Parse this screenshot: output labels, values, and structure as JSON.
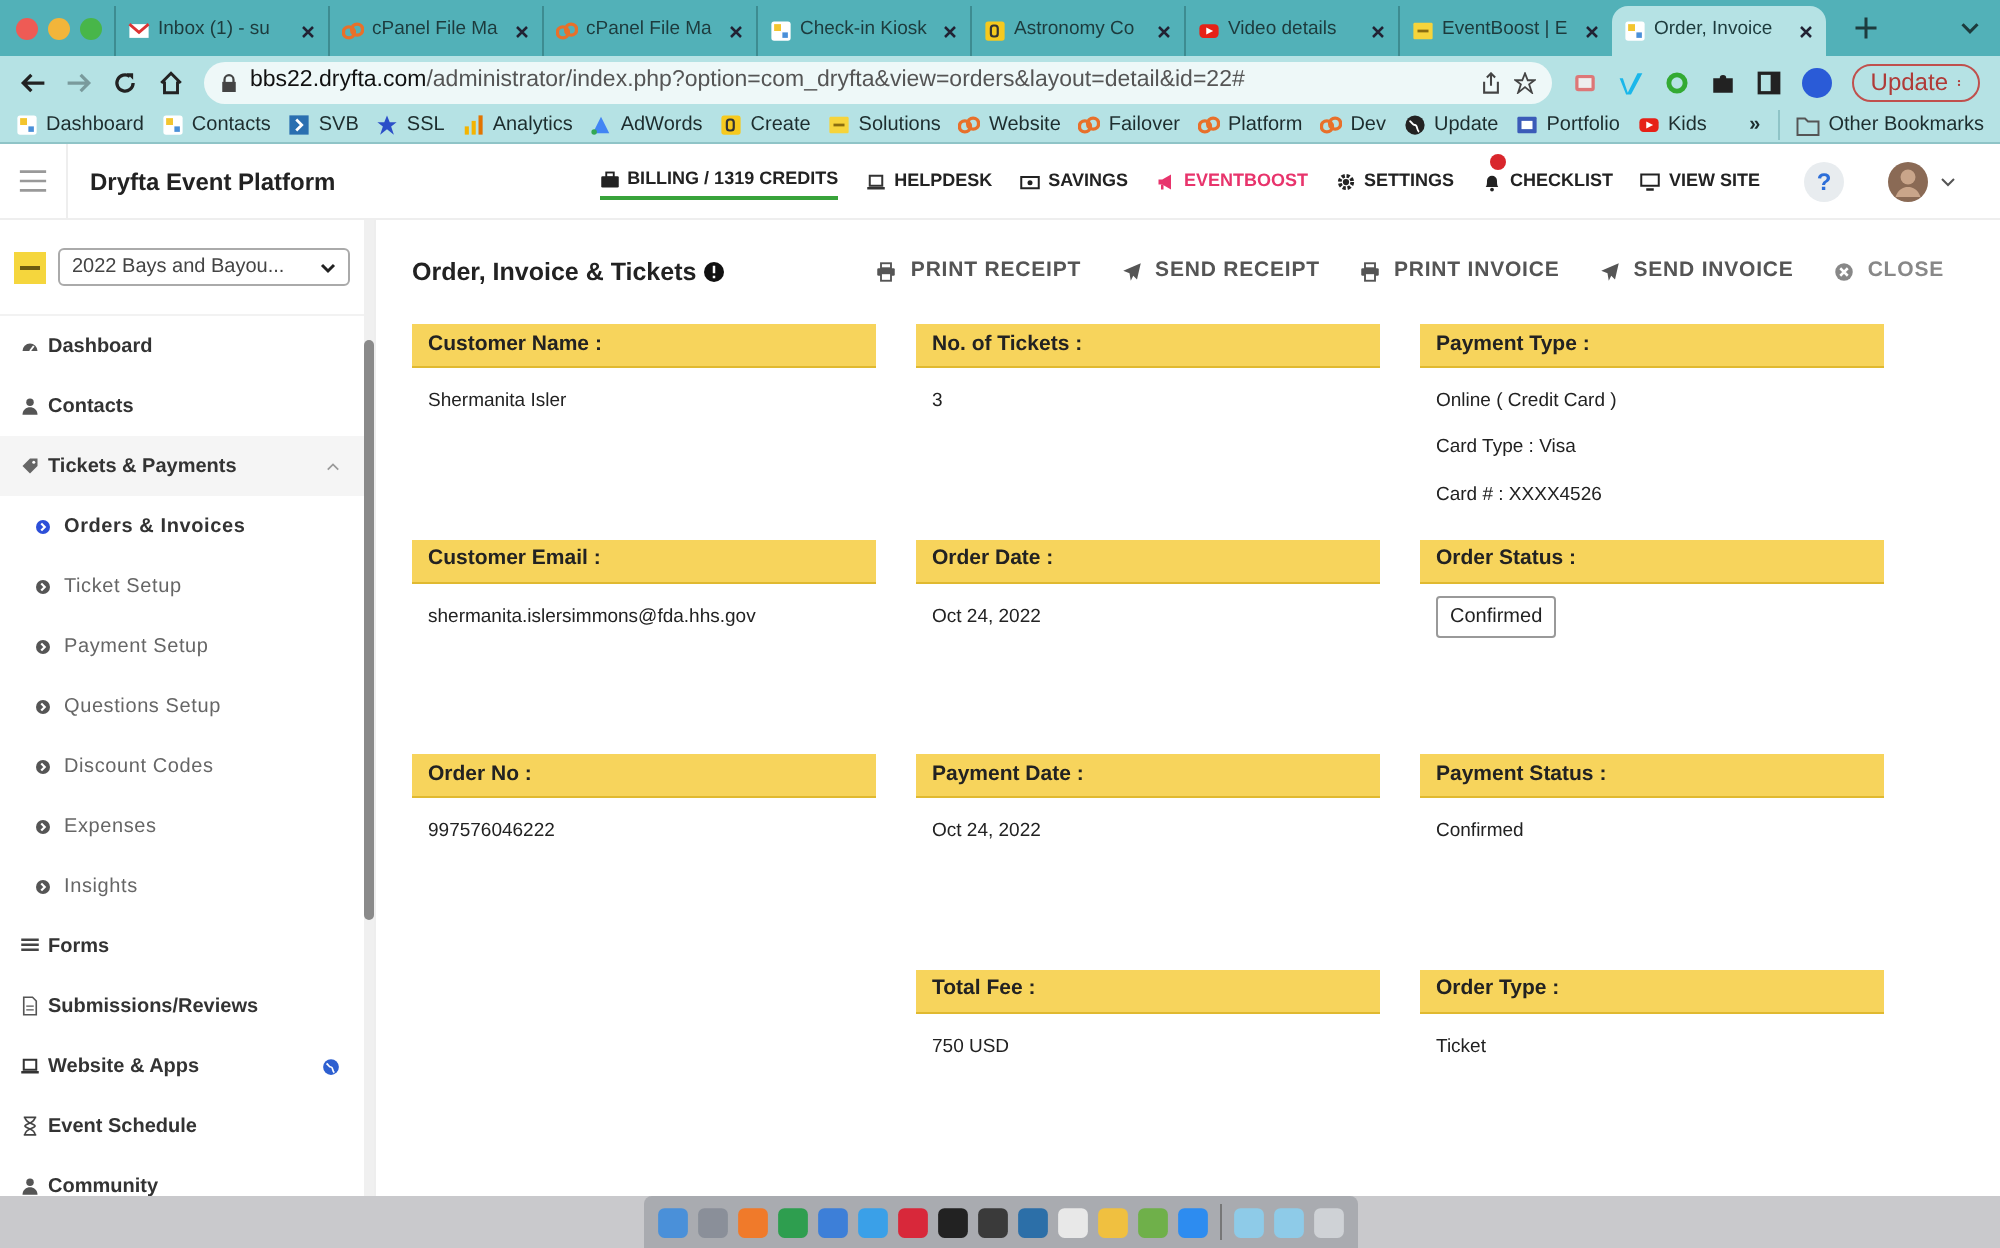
{
  "browser": {
    "tabs": [
      {
        "title": "Inbox (1) - su",
        "selected": false
      },
      {
        "title": "cPanel File Ma",
        "selected": false
      },
      {
        "title": "cPanel File Ma",
        "selected": false
      },
      {
        "title": "Check-in Kiosk",
        "selected": false
      },
      {
        "title": "Astronomy Co",
        "selected": false
      },
      {
        "title": "Video details",
        "selected": false
      },
      {
        "title": "EventBoost | E",
        "selected": false
      },
      {
        "title": "Order, Invoice",
        "selected": true
      }
    ],
    "url_host": "bbs22.dryfta.com",
    "url_path": "/administrator/index.php?option=com_dryfta&view=orders&layout=detail&id=22#",
    "update_button": "Update",
    "bookmarks": [
      "Dashboard",
      "Contacts",
      "SVB",
      "SSL",
      "Analytics",
      "AdWords",
      "Create",
      "Solutions",
      "Website",
      "Failover",
      "Platform",
      "Dev",
      "Update",
      "Portfolio",
      "Kids"
    ],
    "more_bookmarks": "»",
    "other_bookmarks": "Other Bookmarks"
  },
  "app": {
    "title": "Dryfta Event Platform",
    "nav": [
      {
        "label": "BILLING / 1319 CREDITS",
        "underlined": true,
        "accent": false,
        "badge": false
      },
      {
        "label": "HELPDESK",
        "underlined": false,
        "accent": false,
        "badge": false
      },
      {
        "label": "SAVINGS",
        "underlined": false,
        "accent": false,
        "badge": false
      },
      {
        "label": "EVENTBOOST",
        "underlined": false,
        "accent": true,
        "badge": false
      },
      {
        "label": "SETTINGS",
        "underlined": false,
        "accent": false,
        "badge": false
      },
      {
        "label": "CHECKLIST",
        "underlined": false,
        "accent": false,
        "badge": true
      },
      {
        "label": "VIEW SITE",
        "underlined": false,
        "accent": false,
        "badge": false
      }
    ],
    "help": "?"
  },
  "sidebar": {
    "event_select": "2022 Bays and Bayou...",
    "items": [
      {
        "label": "Dashboard",
        "badge": false
      },
      {
        "label": "Contacts",
        "badge": false
      },
      {
        "label": "Tickets & Payments",
        "expanded": true,
        "badge": false,
        "children": [
          {
            "label": "Orders & Invoices",
            "selected": true
          },
          {
            "label": "Ticket Setup",
            "selected": false
          },
          {
            "label": "Payment Setup",
            "selected": false
          },
          {
            "label": "Questions Setup",
            "selected": false
          },
          {
            "label": "Discount Codes",
            "selected": false
          },
          {
            "label": "Expenses",
            "selected": false
          },
          {
            "label": "Insights",
            "selected": false
          }
        ]
      },
      {
        "label": "Forms",
        "badge": false
      },
      {
        "label": "Submissions/Reviews",
        "badge": false
      },
      {
        "label": "Website & Apps",
        "badge": true
      },
      {
        "label": "Event Schedule",
        "badge": false
      },
      {
        "label": "Community",
        "badge": false
      }
    ]
  },
  "page": {
    "title": "Order, Invoice & Tickets",
    "actions": [
      "PRINT RECEIPT",
      "SEND RECEIPT",
      "PRINT INVOICE",
      "SEND INVOICE",
      "CLOSE"
    ],
    "columns": [
      [
        {
          "label": "Customer Name :",
          "kind": "text",
          "lines": [
            "Shermanita Isler"
          ]
        },
        {
          "label": "Customer Email :",
          "kind": "text",
          "lines": [
            "shermanita.islersimmons@fda.hhs.gov"
          ]
        },
        {
          "label": "Order No :",
          "kind": "text",
          "lines": [
            "997576046222"
          ]
        }
      ],
      [
        {
          "label": "No. of Tickets :",
          "kind": "text",
          "lines": [
            "3"
          ]
        },
        {
          "label": "Order Date :",
          "kind": "text",
          "lines": [
            "Oct 24, 2022"
          ]
        },
        {
          "label": "Payment Date :",
          "kind": "text",
          "lines": [
            "Oct 24, 2022"
          ]
        },
        {
          "label": "Total Fee :",
          "kind": "text",
          "lines": [
            "750 USD"
          ]
        }
      ],
      [
        {
          "label": "Payment Type :",
          "kind": "text",
          "lines": [
            "Online ( Credit Card )",
            "Card Type : Visa",
            "Card # : XXXX4526"
          ]
        },
        {
          "label": "Order Status :",
          "kind": "status",
          "lines": [
            "Confirmed"
          ]
        },
        {
          "label": "Payment Status :",
          "kind": "text",
          "lines": [
            "Confirmed"
          ]
        },
        {
          "label": "Order Type :",
          "kind": "text",
          "lines": [
            "Ticket"
          ]
        }
      ]
    ]
  }
}
